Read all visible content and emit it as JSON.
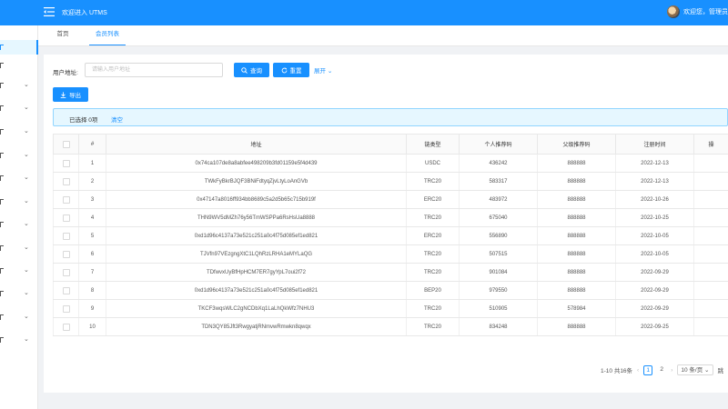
{
  "header": {
    "welcome": "欢迎进入 UTMS",
    "user_text": "欢迎您，管理员"
  },
  "sidebar": {
    "items": [
      {
        "icon": "menu-icon",
        "has_chevron": false,
        "active": true
      },
      {
        "icon": "menu-icon",
        "has_chevron": false,
        "active": false
      },
      {
        "icon": "menu-icon",
        "has_chevron": true,
        "active": false
      },
      {
        "icon": "menu-icon",
        "has_chevron": true,
        "active": false
      },
      {
        "icon": "menu-icon",
        "has_chevron": true,
        "active": false
      },
      {
        "icon": "menu-icon",
        "has_chevron": true,
        "active": false
      },
      {
        "icon": "menu-icon",
        "has_chevron": true,
        "active": false
      },
      {
        "icon": "menu-icon",
        "has_chevron": true,
        "active": false
      },
      {
        "icon": "menu-icon",
        "has_chevron": true,
        "active": false
      },
      {
        "icon": "menu-icon",
        "has_chevron": true,
        "active": false
      },
      {
        "icon": "menu-icon",
        "has_chevron": true,
        "active": false
      },
      {
        "icon": "menu-icon",
        "has_chevron": true,
        "active": false
      },
      {
        "icon": "menu-icon",
        "has_chevron": true,
        "active": false
      },
      {
        "icon": "menu-icon",
        "has_chevron": true,
        "active": false
      }
    ]
  },
  "tabs": {
    "home": "首页",
    "active": "会员列表"
  },
  "search": {
    "label": "用户地址:",
    "placeholder": "请输入用户地址",
    "value": "",
    "query_label": "查询",
    "reset_label": "重置",
    "expand_label": "展开"
  },
  "toolbar": {
    "export_label": "导出"
  },
  "alert": {
    "selected_text": "已选择 0项",
    "clear_label": "清空"
  },
  "table": {
    "columns": [
      "",
      "#",
      "地址",
      "链类型",
      "个人推荐码",
      "父级推荐码",
      "注册时间",
      "操"
    ],
    "rows": [
      [
        "1",
        "0x74ca107de8a8abfee498209b3fd01159e5f4d439",
        "USDC",
        "436242",
        "888888",
        "2022-12-13"
      ],
      [
        "2",
        "TWkFyBkrBJQF3BNiFdtyqZjvLtyLoAnGVb",
        "TRC20",
        "583317",
        "888888",
        "2022-12-13"
      ],
      [
        "3",
        "0x47147a8016ff934bb8689c5a2d5b65c715b919f",
        "ERC20",
        "483972",
        "888888",
        "2022-10-26"
      ],
      [
        "4",
        "THN9WV5dMZh76y56TmWSPPa6RsHsUa8888",
        "TRC20",
        "675040",
        "888888",
        "2022-10-25"
      ],
      [
        "5",
        "0xd1d96c4137a73e521c251a0c4f75d085ef1ed821",
        "ERC20",
        "556890",
        "888888",
        "2022-10-05"
      ],
      [
        "6",
        "TJVfn97VEzgngXtC1LQhRzLRHA1eMYLaQG",
        "TRC20",
        "507515",
        "888888",
        "2022-10-05"
      ],
      [
        "7",
        "TDfwvxUyBfHpHCM7ER7gyYpL7oui2f72",
        "TRC20",
        "901084",
        "888888",
        "2022-09-29"
      ],
      [
        "8",
        "0xd1d96c4137a73e521c251a0c4f75d085ef1ed821",
        "BEP20",
        "979550",
        "888888",
        "2022-09-29"
      ],
      [
        "9",
        "TKCF3wqsWLC2gNCDbXq1LaLhQkWfz7NHU3",
        "TRC20",
        "510905",
        "578984",
        "2022-09-29"
      ],
      [
        "10",
        "TDN3QY85Jft3RwgyatjRNmvwRmwkn8qwqx",
        "TRC20",
        "834248",
        "888888",
        "2022-09-25"
      ]
    ]
  },
  "pagination": {
    "total_text": "1-10 共16条",
    "pages": [
      "1",
      "2"
    ],
    "current_page": "1",
    "page_size_label": "10 条/页",
    "jump_label": "跳"
  }
}
